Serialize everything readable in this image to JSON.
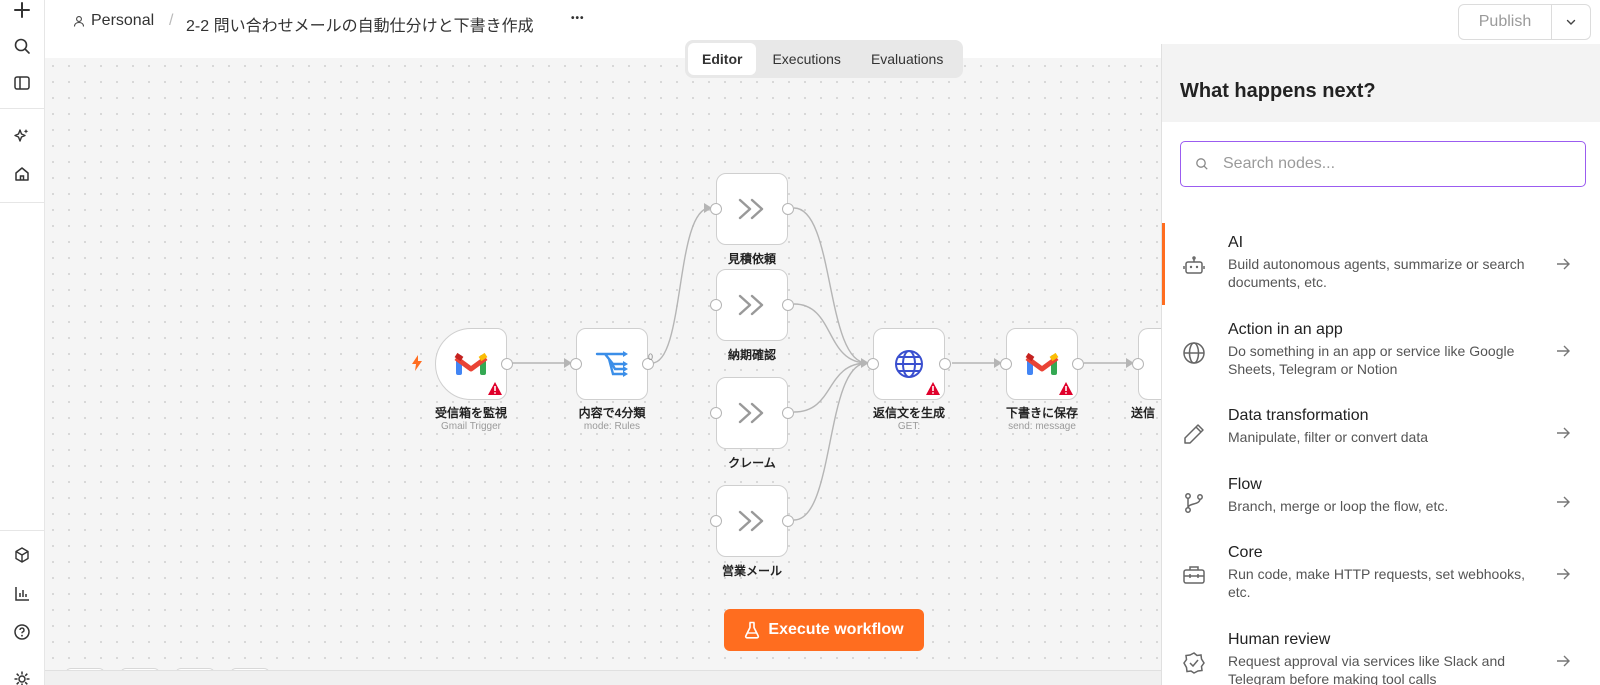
{
  "header": {
    "workspace": "Personal",
    "separator": "/",
    "workflow_name": "2-2 問い合わせメールの自動仕分けと下書き作成",
    "more": "•••",
    "publish_label": "Publish"
  },
  "tabs": [
    {
      "label": "Editor",
      "active": true
    },
    {
      "label": "Executions",
      "active": false
    },
    {
      "label": "Evaluations",
      "active": false
    }
  ],
  "nodes": {
    "gmail_trigger": {
      "label": "受信箱を監視",
      "sub": "Gmail Trigger"
    },
    "switch": {
      "label": "内容で4分類",
      "sub": "mode: Rules",
      "output_index": "0"
    },
    "quote": {
      "label": "見積依頼"
    },
    "delivery": {
      "label": "納期確認"
    },
    "complaint": {
      "label": "クレーム"
    },
    "sales": {
      "label": "営業メール"
    },
    "http": {
      "label": "返信文を生成",
      "sub": "GET:"
    },
    "draft": {
      "label": "下書きに保存",
      "sub": "send: message"
    },
    "send": {
      "label": "送信"
    }
  },
  "execute_label": "Execute workflow",
  "panel": {
    "title": "What happens next?",
    "search_placeholder": "Search nodes...",
    "categories": [
      {
        "title": "AI",
        "desc": "Build autonomous agents, summarize or search documents, etc.",
        "icon": "robot-icon"
      },
      {
        "title": "Action in an app",
        "desc": "Do something in an app or service like Google Sheets, Telegram or Notion",
        "icon": "globe-icon"
      },
      {
        "title": "Data transformation",
        "desc": "Manipulate, filter or convert data",
        "icon": "pen-icon"
      },
      {
        "title": "Flow",
        "desc": "Branch, merge or loop the flow, etc.",
        "icon": "branch-icon"
      },
      {
        "title": "Core",
        "desc": "Run code, make HTTP requests, set webhooks, etc.",
        "icon": "toolbox-icon"
      },
      {
        "title": "Human review",
        "desc": "Request approval via services like Slack and Telegram before making tool calls",
        "icon": "check-shield-icon"
      }
    ]
  },
  "colors": {
    "accent": "#ff6d1f",
    "search_border": "#9b5cf0",
    "warning": "#e0002b"
  }
}
